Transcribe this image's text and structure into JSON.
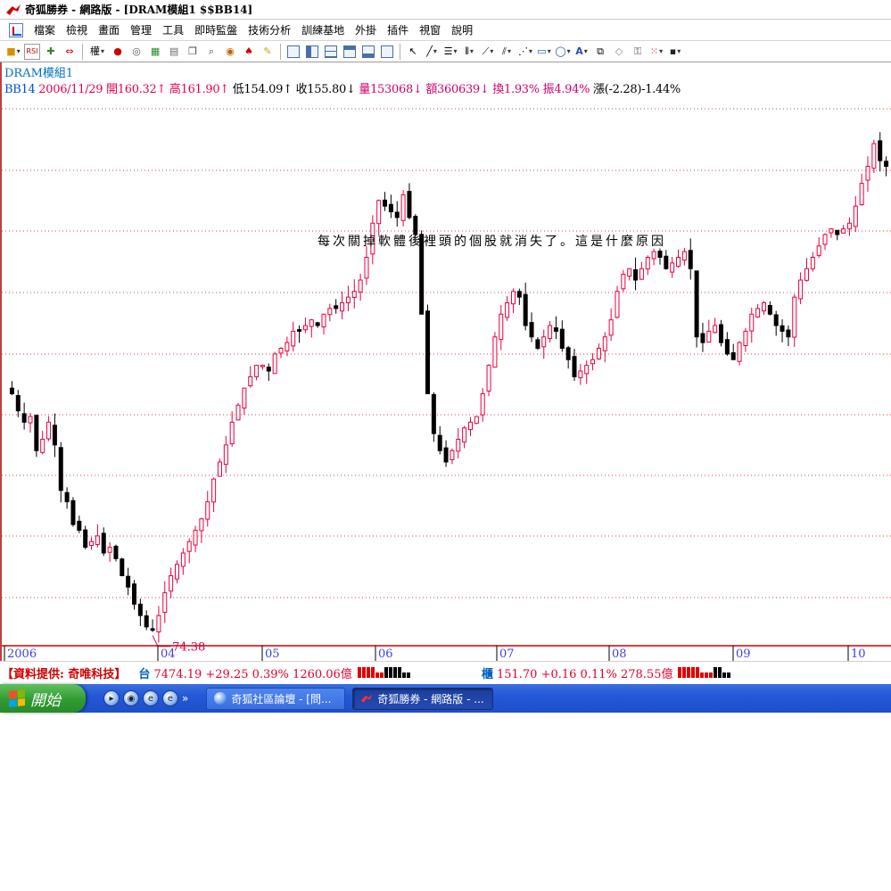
{
  "window": {
    "title": "奇狐勝券 - 網路版 - [DRAM模組1 $$BB14]"
  },
  "menu": {
    "items": [
      "檔案",
      "檢視",
      "畫面",
      "管理",
      "工具",
      "即時監盤",
      "技術分析",
      "訓練基地",
      "外掛",
      "插件",
      "視窗",
      "說明"
    ]
  },
  "toolbar": {
    "text_button_label": "權"
  },
  "chart": {
    "group_name": "DRAM模組1",
    "symbol": "BB14",
    "date": "2006/11/29",
    "open_label": "開160.32",
    "high_label": "高161.90",
    "low_label": "低154.09",
    "close_label": "收155.80",
    "volume_label": "量153068",
    "amount_label": "額360639",
    "turnover_label": "換1.93%",
    "amplitude_label": "振4.94%",
    "change_label": "漲(-2.28)-1.44%",
    "annotation": "每次關掉軟體後裡頭的個股就消失了。這是什麼原因",
    "low_marker_label": "74.38"
  },
  "chart_data": {
    "type": "candlestick",
    "x_labels": [
      "2006",
      "04",
      "05",
      "06",
      "07",
      "08",
      "09",
      "10"
    ],
    "y_range": [
      72,
      168
    ],
    "annotated_low": 74.38,
    "last_close": 155.8,
    "grid": "horizontal dotted red lines",
    "up_color": "#e8003c",
    "down_color": "#000000",
    "closes": [
      116,
      113,
      111,
      112,
      106,
      108,
      111,
      107,
      99,
      97,
      93,
      92,
      89,
      90,
      91,
      88,
      89,
      87,
      84,
      82,
      79,
      77,
      75,
      74.4,
      77,
      81,
      84,
      86,
      88,
      90,
      92,
      94,
      97,
      101,
      104,
      107,
      111,
      114,
      117,
      119,
      121,
      121,
      120,
      123,
      124,
      125,
      127,
      127,
      128,
      129,
      128,
      130,
      131,
      131,
      132,
      133,
      134,
      136,
      140,
      146,
      150,
      149,
      148,
      147,
      151,
      147,
      144,
      130,
      116,
      109,
      106,
      104,
      106,
      108,
      110,
      111,
      112,
      116,
      121,
      126,
      130,
      132,
      134,
      133,
      128,
      126,
      124,
      126,
      128,
      127,
      124,
      122,
      119,
      120,
      121,
      122,
      124,
      126,
      129,
      134,
      137,
      138,
      136,
      138,
      140,
      141,
      140,
      138,
      139,
      140,
      141,
      138,
      126,
      125,
      127,
      128,
      125,
      123,
      122,
      125,
      127,
      130,
      131,
      132,
      130,
      128,
      127,
      126,
      133,
      136,
      138,
      140,
      142,
      144,
      145,
      144,
      145,
      146,
      149,
      153,
      156,
      160,
      157,
      156
    ]
  },
  "statusbar": {
    "provider": "【資料提供: 奇唯科技】",
    "twse_label": "台",
    "twse_value": "7474.19 +29.25 0.39% 1260.06億",
    "otc_label": "櫃",
    "otc_value": "151.70 +0.16 0.11% 278.55億"
  },
  "taskbar": {
    "start_label": "開始",
    "tasks": [
      {
        "label": "奇狐社區論壇 - [問...",
        "active": false
      },
      {
        "label": "奇狐勝券 - 網路版 - ...",
        "active": true
      }
    ]
  }
}
